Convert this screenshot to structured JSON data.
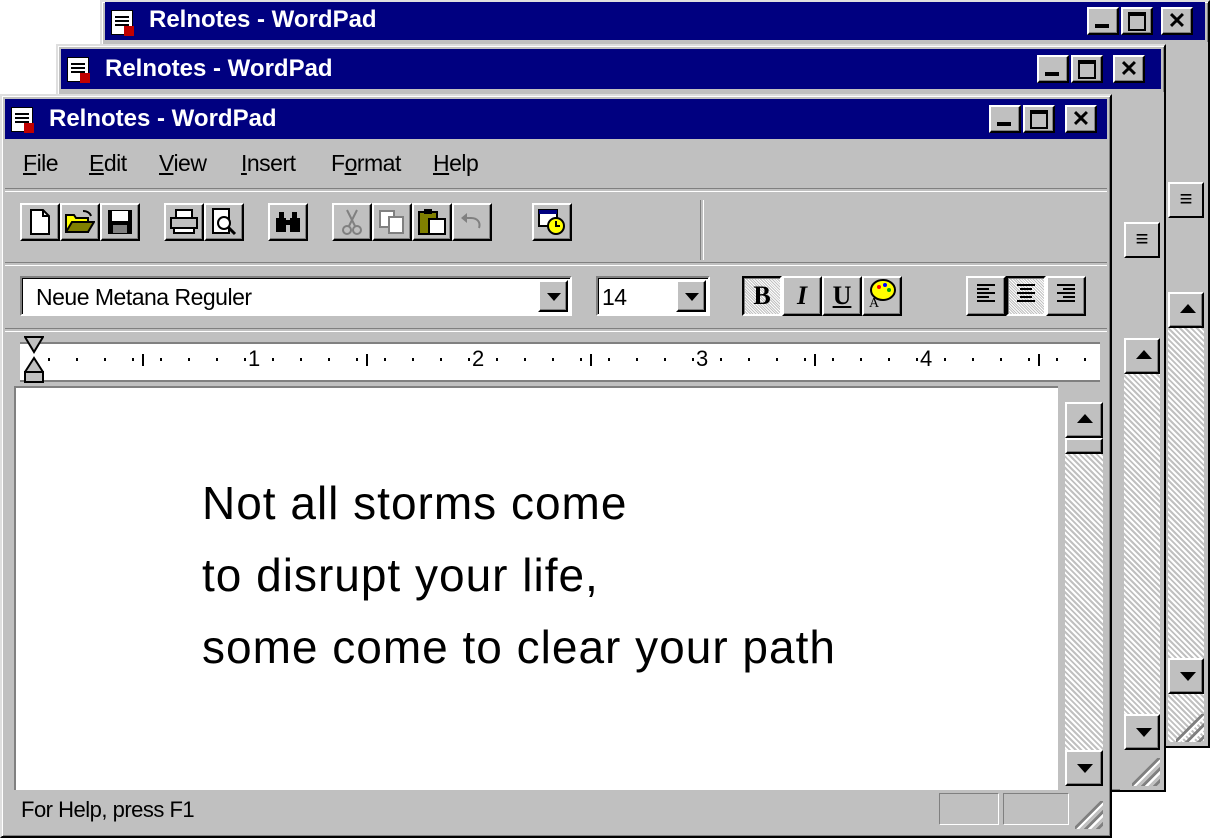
{
  "windows": [
    {
      "title": "Relnotes - WordPad"
    },
    {
      "title": "Relnotes - WordPad"
    },
    {
      "title": "Relnotes - WordPad"
    }
  ],
  "menu": [
    {
      "pre": "",
      "key": "F",
      "post": "ile"
    },
    {
      "pre": "",
      "key": "E",
      "post": "dit"
    },
    {
      "pre": "",
      "key": "V",
      "post": "iew"
    },
    {
      "pre": "",
      "key": "I",
      "post": "nsert"
    },
    {
      "pre": "F",
      "key": "o",
      "post": "rmat"
    },
    {
      "pre": "",
      "key": "H",
      "post": "elp"
    }
  ],
  "toolbar": {
    "icons": [
      "new-icon",
      "open-icon",
      "save-icon",
      "print-icon",
      "print-preview-icon",
      "find-icon",
      "cut-icon",
      "copy-icon",
      "paste-icon",
      "undo-icon",
      "date-time-icon"
    ]
  },
  "format": {
    "font": "Neue Metana Reguler",
    "size": "14",
    "bold": "B",
    "italic": "I",
    "underline": "U"
  },
  "ruler": {
    "numbers": [
      "1",
      "2",
      "3",
      "4"
    ]
  },
  "document": {
    "lines": [
      "Not all storms come",
      "to disrupt your life,",
      "some come to clear your path"
    ]
  },
  "status": {
    "text": "For Help, press F1"
  }
}
